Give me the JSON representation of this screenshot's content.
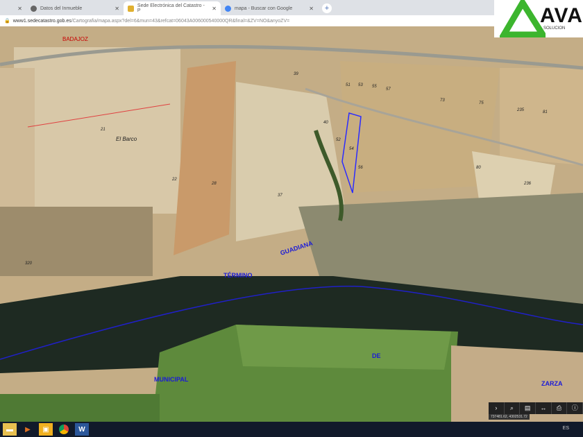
{
  "browser": {
    "tabs": [
      {
        "label": "Datos del Inmueble",
        "active": false
      },
      {
        "label": "Sede Electrónica del Catastro - P",
        "active": true
      },
      {
        "label": "mapa - Buscar con Google",
        "active": false
      }
    ],
    "url_domain": "www1.sedecatastro.gob.es",
    "url_path": "/Cartografia/mapa.aspx?del=6&mun=43&refcat=06043A006000540000QR&final=&ZV=NO&anyoZV="
  },
  "logo": {
    "text": "AVA",
    "subtitle": "SOLUCION"
  },
  "map": {
    "labels": {
      "road": "BADAJOZ",
      "place": "El Barco",
      "river": "GUADIANA",
      "t1": "TÉRMINO",
      "t2": "MUNICIPAL",
      "t3": "DE",
      "t4": "ZARZA"
    },
    "parcels": [
      "21",
      "22",
      "28",
      "37",
      "39",
      "40",
      "51",
      "52",
      "53",
      "54",
      "55",
      "56",
      "57",
      "73",
      "75",
      "235",
      "81",
      "236",
      "80",
      "320"
    ],
    "highlight_color": "#2b2bff"
  },
  "toolbar": {
    "icons": [
      "arrow-right",
      "search",
      "layers",
      "measure",
      "print",
      "info"
    ],
    "coords": "737481.62, 4302531.72"
  },
  "taskbar": {
    "language": "ES"
  }
}
